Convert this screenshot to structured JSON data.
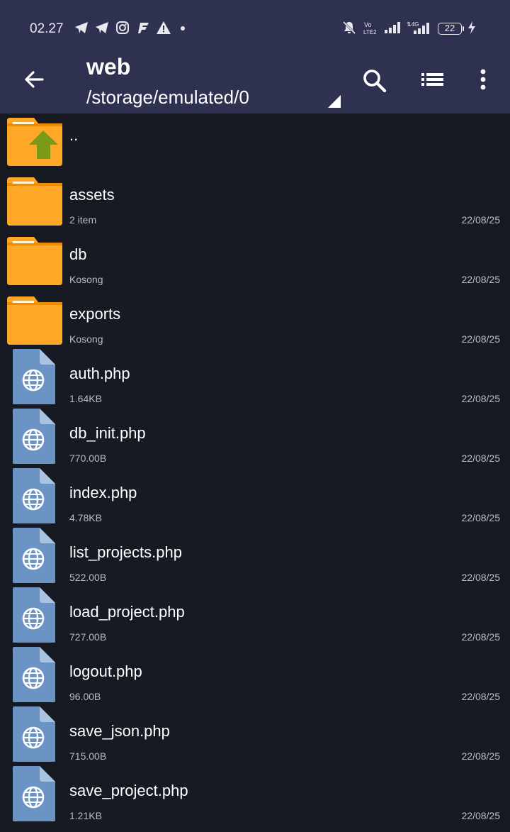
{
  "status_bar": {
    "time": "02.27",
    "battery_level": "22",
    "icons": [
      "telegram-icon",
      "telegram-icon",
      "instagram-icon",
      "flash-icon",
      "warning-icon",
      "dot-icon",
      "mute-icon",
      "volte-icon",
      "signal-icon",
      "4g-signal-icon",
      "battery-icon",
      "charging-icon"
    ]
  },
  "app_bar": {
    "title": "web",
    "path": "/storage/emulated/0"
  },
  "colors": {
    "app_bar_bg": "#2e3150",
    "list_bg": "#171a22",
    "folder": "#ffa726",
    "file": "#6b93c4",
    "up_arrow": "#7a9a1a"
  },
  "parent_entry": {
    "name": ".."
  },
  "items": [
    {
      "type": "folder",
      "name": "assets",
      "meta": "2 item",
      "date": "22/08/25"
    },
    {
      "type": "folder",
      "name": "db",
      "meta": "Kosong",
      "date": "22/08/25"
    },
    {
      "type": "folder",
      "name": "exports",
      "meta": "Kosong",
      "date": "22/08/25"
    },
    {
      "type": "file",
      "name": "auth.php",
      "meta": "1.64KB",
      "date": "22/08/25"
    },
    {
      "type": "file",
      "name": "db_init.php",
      "meta": "770.00B",
      "date": "22/08/25"
    },
    {
      "type": "file",
      "name": "index.php",
      "meta": "4.78KB",
      "date": "22/08/25"
    },
    {
      "type": "file",
      "name": "list_projects.php",
      "meta": "522.00B",
      "date": "22/08/25"
    },
    {
      "type": "file",
      "name": "load_project.php",
      "meta": "727.00B",
      "date": "22/08/25"
    },
    {
      "type": "file",
      "name": "logout.php",
      "meta": "96.00B",
      "date": "22/08/25"
    },
    {
      "type": "file",
      "name": "save_json.php",
      "meta": "715.00B",
      "date": "22/08/25"
    },
    {
      "type": "file",
      "name": "save_project.php",
      "meta": "1.21KB",
      "date": "22/08/25"
    }
  ]
}
